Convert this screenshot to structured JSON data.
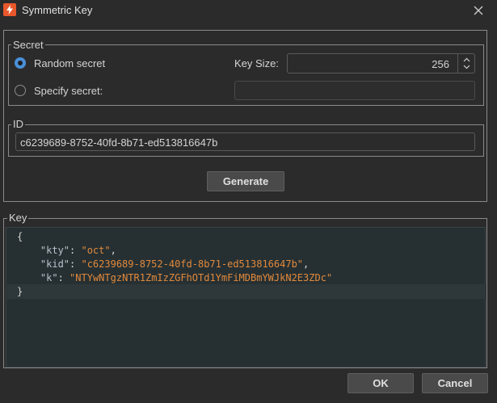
{
  "window": {
    "title": "Symmetric Key",
    "icon": "burp-lightning-icon",
    "close_icon": "close-icon"
  },
  "secret": {
    "legend": "Secret",
    "random_label": "Random secret",
    "specify_label": "Specify secret:",
    "selected": "Random secret",
    "key_size_label": "Key Size:",
    "key_size_value": "256",
    "specify_value": ""
  },
  "id": {
    "legend": "ID",
    "value": "c6239689-8752-40fd-8b71-ed513816647b"
  },
  "generate_label": "Generate",
  "key": {
    "legend": "Key",
    "lines": {
      "open": "{",
      "kty_key": "\"kty\"",
      "kty_val": "\"oct\"",
      "kid_key": "\"kid\"",
      "kid_val": "\"c6239689-8752-40fd-8b71-ed513816647b\"",
      "k_key": "\"k\"",
      "k_val": "\"NTYwNTgzNTR1ZmIzZGFhOTd1YmFiMDBmYWJkN2E3ZDc\"",
      "close": "}"
    }
  },
  "buttons": {
    "ok": "OK",
    "cancel": "Cancel"
  },
  "colors": {
    "accent": "#4a90d9",
    "string": "#e2893b",
    "icon_bg": "#e8582b"
  }
}
